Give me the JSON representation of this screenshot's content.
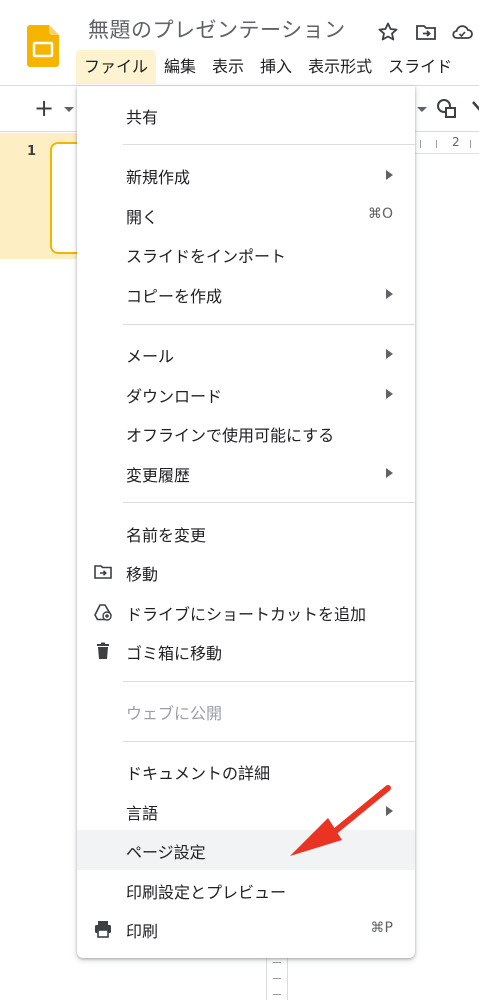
{
  "header": {
    "doc_title": "無題のプレゼンテーション",
    "icons": [
      "star-icon",
      "move-to-folder-icon",
      "cloud-status-icon"
    ]
  },
  "menubar": {
    "items": [
      "ファイル",
      "編集",
      "表示",
      "挿入",
      "表示形式",
      "スライド"
    ],
    "active": "ファイル"
  },
  "toolbar": {
    "new_slide_label": "+",
    "ruler_number": "2"
  },
  "slides": {
    "current_number": "1"
  },
  "file_menu": {
    "items": [
      {
        "label": "共有"
      },
      {
        "label": "新規作成",
        "submenu": true
      },
      {
        "label": "開く",
        "shortcut": "⌘O"
      },
      {
        "label": "スライドをインポート"
      },
      {
        "label": "コピーを作成",
        "submenu": true
      },
      {
        "label": "メール",
        "submenu": true
      },
      {
        "label": "ダウンロード",
        "submenu": true
      },
      {
        "label": "オフラインで使用可能にする"
      },
      {
        "label": "変更履歴",
        "submenu": true
      },
      {
        "label": "名前を変更"
      },
      {
        "label": "移動",
        "icon": "move-folder-icon"
      },
      {
        "label": "ドライブにショートカットを追加",
        "icon": "drive-shortcut-icon"
      },
      {
        "label": "ゴミ箱に移動",
        "icon": "trash-icon"
      },
      {
        "label": "ウェブに公開",
        "disabled": true
      },
      {
        "label": "ドキュメントの詳細"
      },
      {
        "label": "言語",
        "submenu": true
      },
      {
        "label": "ページ設定",
        "highlighted": true
      },
      {
        "label": "印刷設定とプレビュー"
      },
      {
        "label": "印刷",
        "icon": "print-icon",
        "shortcut": "⌘P"
      }
    ]
  },
  "annotation": {
    "arrow_color": "#ea3323",
    "points_to": "ページ設定"
  },
  "colors": {
    "menu_active_bg": "#fdf3d0",
    "slide_selected_bg": "#fdefc3",
    "slide_border": "#f4b400",
    "logo_yellow": "#f4b400",
    "hover_row": "#f1f3f4"
  }
}
